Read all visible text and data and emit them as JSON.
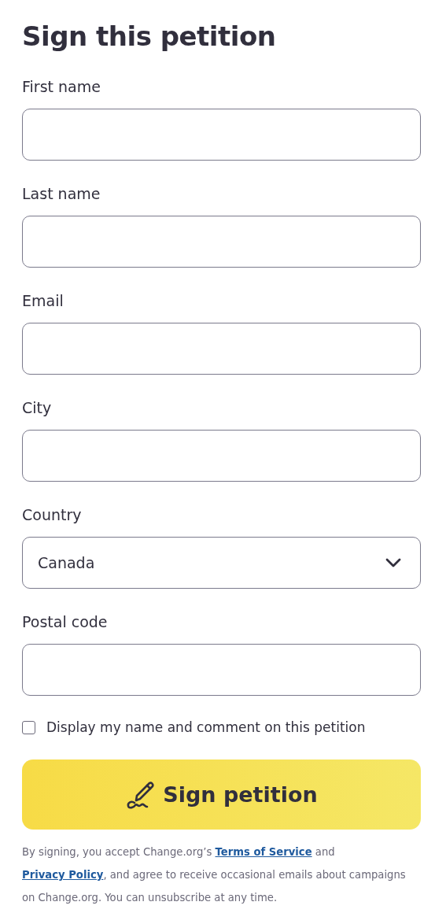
{
  "title": "Sign this petition",
  "fields": [
    {
      "label": "First name",
      "kind": "text"
    },
    {
      "label": "Last name",
      "kind": "text"
    },
    {
      "label": "Email",
      "kind": "text"
    },
    {
      "label": "City",
      "kind": "text"
    },
    {
      "label": "Country",
      "kind": "select",
      "value": "Canada"
    },
    {
      "label": "Postal code",
      "kind": "text"
    }
  ],
  "display_option": {
    "label": "Display my name and comment on this petition",
    "checked": false
  },
  "submit_button": {
    "label": "Sign petition"
  },
  "legal": [
    {
      "kind": "text",
      "text": "By signing, you accept Change.org’s "
    },
    {
      "kind": "link",
      "text": "Terms of Service"
    },
    {
      "kind": "text",
      "text": " and "
    },
    {
      "kind": "link",
      "text": "Privacy Policy"
    },
    {
      "kind": "text",
      "text": ", and agree to receive occasional emails about campaigns on Change.org. You can unsubscribe at any time."
    }
  ]
}
